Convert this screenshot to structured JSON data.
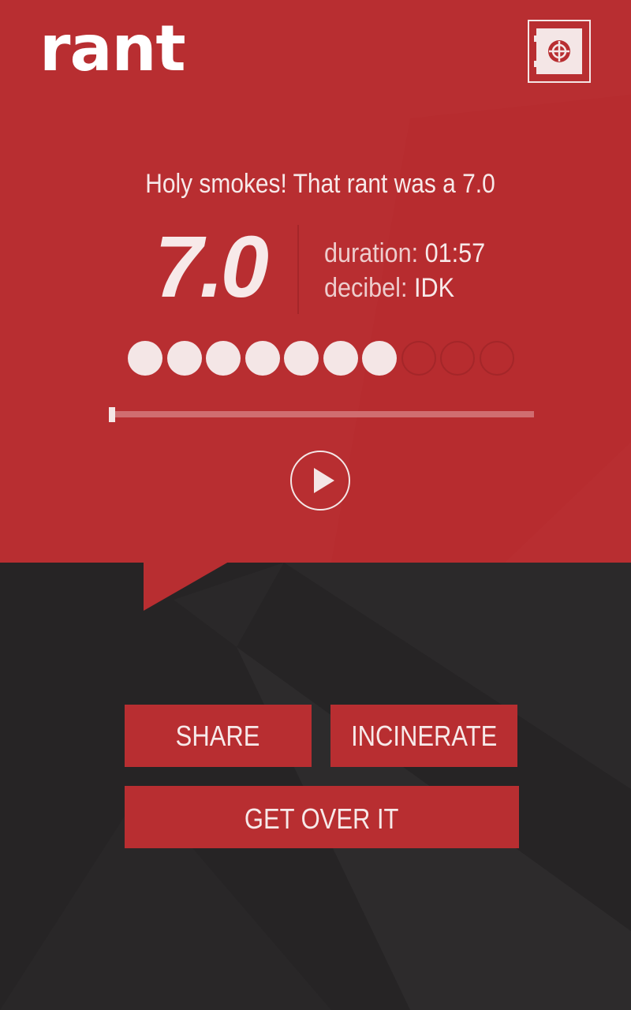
{
  "app": {
    "logo_text": "rant"
  },
  "header": {
    "vault_icon": "safe-icon"
  },
  "result": {
    "headline": "Holy smokes! That rant was a 7.0",
    "score_display": "7.0",
    "score": 7,
    "score_max": 10,
    "duration_label": "duration:",
    "duration_value": "01:57",
    "decibel_label": "decibel:",
    "decibel_value": "IDK"
  },
  "player": {
    "progress_fraction": 0.0,
    "play_icon": "play-icon"
  },
  "actions": {
    "share_label": "SHARE",
    "incinerate_label": "INCINERATE",
    "get_over_label": "GET OVER IT"
  },
  "colors": {
    "accent_red": "#b82e31",
    "dark_bg": "#262425",
    "light_text": "#f7e9e9"
  }
}
